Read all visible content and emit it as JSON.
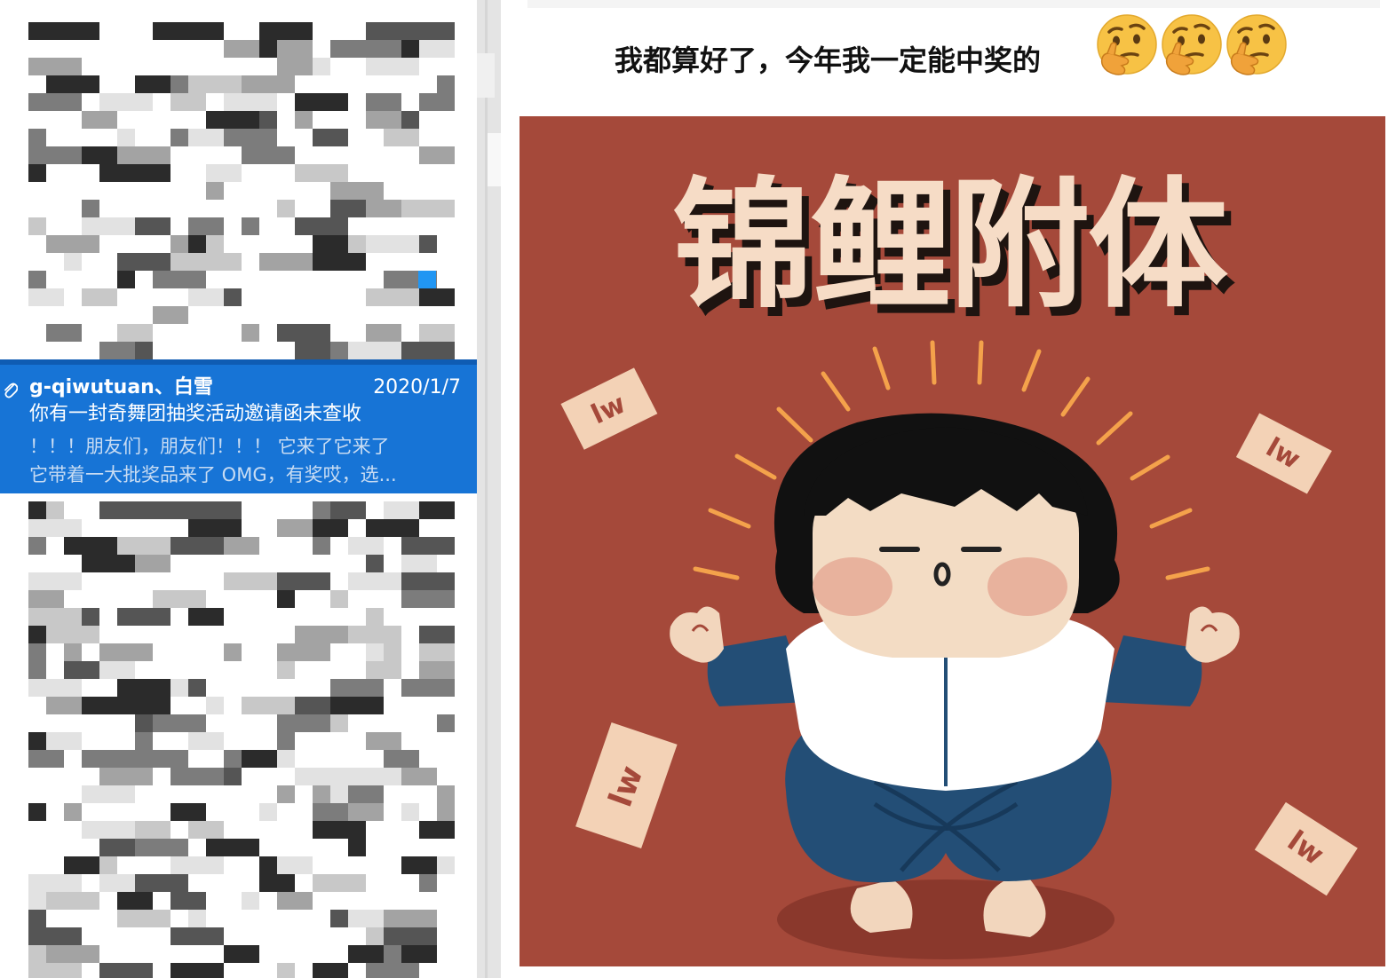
{
  "mail_list": {
    "selected_item": {
      "sender": "g-qiwutuan、白雪",
      "date": "2020/1/7",
      "subject": "你有一封奇舞团抽奖活动邀请函未查收",
      "preview_line1": "！！！朋友们，朋友们！！！ 它来了它来了",
      "preview_line2": "它带着一大批奖品来了 OMG，有奖哎，选..."
    }
  },
  "content": {
    "message_text": "我都算好了，今年我一定能中奖的",
    "emoji_icon": "thinking-face-icon",
    "poster": {
      "title": "锦鲤附体",
      "background_color": "#a5493a",
      "title_color": "#f6dcc6",
      "coupon_text": "lw"
    }
  },
  "colors": {
    "selection_blue": "#1774d6",
    "emoji_yellow": "#f7c245"
  }
}
